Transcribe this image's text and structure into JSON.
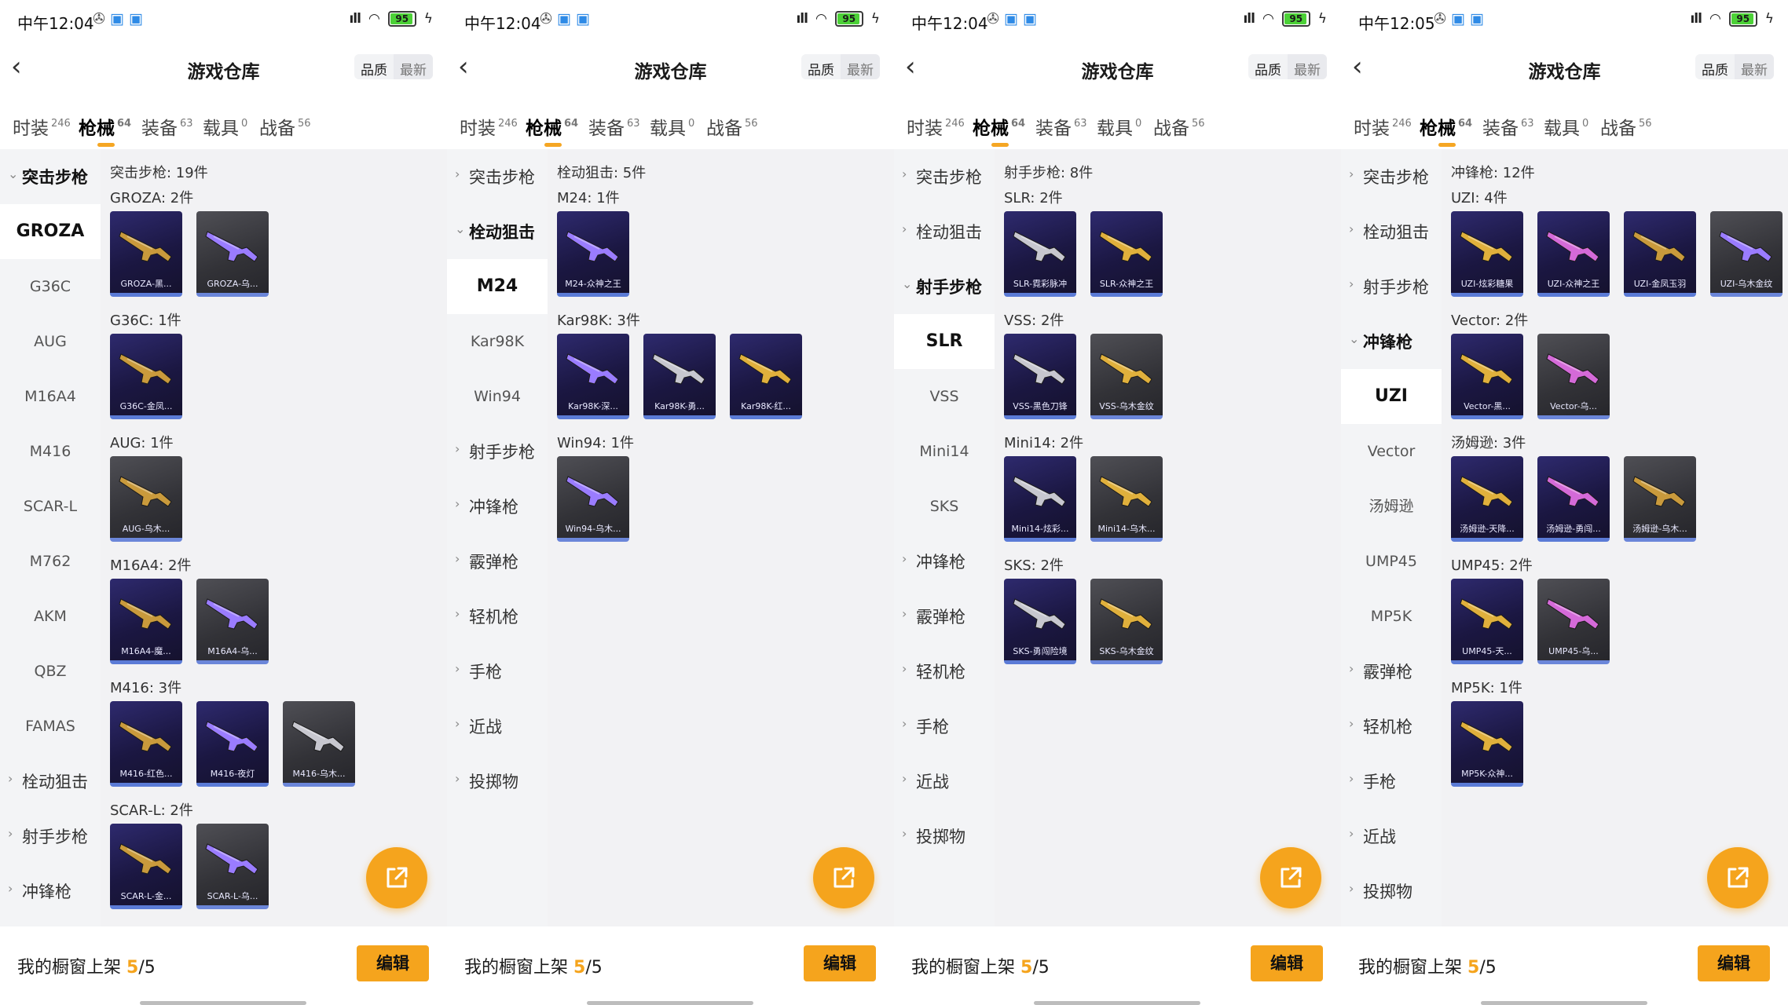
{
  "status_bars": [
    {
      "time": "中午12:04",
      "battery": "95"
    },
    {
      "time": "中午12:04",
      "battery": "95"
    },
    {
      "time": "中午12:04",
      "battery": "95"
    },
    {
      "time": "中午12:05",
      "battery": "95"
    }
  ],
  "header": {
    "title": "游戏仓库",
    "sort_quality": "品质",
    "sort_newest": "最新"
  },
  "tabs": [
    {
      "label": "时装",
      "count": "246"
    },
    {
      "label": "枪械",
      "count": "64"
    },
    {
      "label": "装备",
      "count": "63"
    },
    {
      "label": "载具",
      "count": "0"
    },
    {
      "label": "战备",
      "count": "56"
    }
  ],
  "bottom": {
    "showcase_label": "我的橱窗上架",
    "showcase_current": "5",
    "showcase_total": "/5",
    "edit_label": "编辑"
  },
  "colors": {
    "accent": "#f5a41d",
    "card_purple": "#1b1742",
    "card_grey": "#323237",
    "sidebar_bg": "#f3f4f6"
  },
  "panels": [
    {
      "sidebar": [
        {
          "type": "group",
          "label": "突击步枪",
          "open": true
        },
        {
          "type": "item",
          "label": "GROZA",
          "selected": true
        },
        {
          "type": "item",
          "label": "G36C"
        },
        {
          "type": "item",
          "label": "AUG"
        },
        {
          "type": "item",
          "label": "M16A4"
        },
        {
          "type": "item",
          "label": "M416"
        },
        {
          "type": "item",
          "label": "SCAR-L"
        },
        {
          "type": "item",
          "label": "M762"
        },
        {
          "type": "item",
          "label": "AKM"
        },
        {
          "type": "item",
          "label": "QBZ"
        },
        {
          "type": "item",
          "label": "FAMAS"
        },
        {
          "type": "group",
          "label": "栓动狙击"
        },
        {
          "type": "group",
          "label": "射手步枪"
        },
        {
          "type": "group",
          "label": "冲锋枪"
        }
      ],
      "category_header": "突击步枪: 19件",
      "sections": [
        {
          "header": "GROZA: 2件",
          "items": [
            {
              "label": "GROZA-黑...",
              "style": "purple"
            },
            {
              "label": "GROZA-乌...",
              "style": "grey"
            }
          ]
        },
        {
          "header": "G36C: 1件",
          "items": [
            {
              "label": "G36C-金凤...",
              "style": "purple"
            }
          ]
        },
        {
          "header": "AUG: 1件",
          "items": [
            {
              "label": "AUG-乌木...",
              "style": "grey"
            }
          ]
        },
        {
          "header": "M16A4: 2件",
          "items": [
            {
              "label": "M16A4-魔...",
              "style": "purple"
            },
            {
              "label": "M16A4-乌...",
              "style": "grey"
            }
          ]
        },
        {
          "header": "M416: 3件",
          "items": [
            {
              "label": "M416-红色...",
              "style": "purple"
            },
            {
              "label": "M416-夜灯",
              "style": "purple"
            },
            {
              "label": "M416-乌木...",
              "style": "grey"
            }
          ]
        },
        {
          "header": "SCAR-L: 2件",
          "items": [
            {
              "label": "SCAR-L-金...",
              "style": "purple"
            },
            {
              "label": "SCAR-L-乌...",
              "style": "grey"
            }
          ]
        }
      ]
    },
    {
      "sidebar": [
        {
          "type": "group",
          "label": "突击步枪"
        },
        {
          "type": "group",
          "label": "栓动狙击",
          "open": true
        },
        {
          "type": "item",
          "label": "M24",
          "selected": true
        },
        {
          "type": "item",
          "label": "Kar98K"
        },
        {
          "type": "item",
          "label": "Win94"
        },
        {
          "type": "group",
          "label": "射手步枪"
        },
        {
          "type": "group",
          "label": "冲锋枪"
        },
        {
          "type": "group",
          "label": "霰弹枪"
        },
        {
          "type": "group",
          "label": "轻机枪"
        },
        {
          "type": "group",
          "label": "手枪"
        },
        {
          "type": "group",
          "label": "近战"
        },
        {
          "type": "group",
          "label": "投掷物"
        }
      ],
      "category_header": "栓动狙击: 5件",
      "sections": [
        {
          "header": "M24: 1件",
          "items": [
            {
              "label": "M24-众神之王",
              "style": "purple"
            }
          ]
        },
        {
          "header": "Kar98K: 3件",
          "items": [
            {
              "label": "Kar98K-深...",
              "style": "purple"
            },
            {
              "label": "Kar98K-勇...",
              "style": "purple"
            },
            {
              "label": "Kar98K-红...",
              "style": "purple"
            }
          ]
        },
        {
          "header": "Win94: 1件",
          "items": [
            {
              "label": "Win94-乌木...",
              "style": "grey"
            }
          ]
        }
      ]
    },
    {
      "sidebar": [
        {
          "type": "group",
          "label": "突击步枪"
        },
        {
          "type": "group",
          "label": "栓动狙击"
        },
        {
          "type": "group",
          "label": "射手步枪",
          "open": true
        },
        {
          "type": "item",
          "label": "SLR",
          "selected": true
        },
        {
          "type": "item",
          "label": "VSS"
        },
        {
          "type": "item",
          "label": "Mini14"
        },
        {
          "type": "item",
          "label": "SKS"
        },
        {
          "type": "group",
          "label": "冲锋枪"
        },
        {
          "type": "group",
          "label": "霰弹枪"
        },
        {
          "type": "group",
          "label": "轻机枪"
        },
        {
          "type": "group",
          "label": "手枪"
        },
        {
          "type": "group",
          "label": "近战"
        },
        {
          "type": "group",
          "label": "投掷物"
        }
      ],
      "category_header": "射手步枪: 8件",
      "sections": [
        {
          "header": "SLR: 2件",
          "items": [
            {
              "label": "SLR-霓彩脉冲",
              "style": "purple"
            },
            {
              "label": "SLR-众神之王",
              "style": "purple"
            }
          ]
        },
        {
          "header": "VSS: 2件",
          "items": [
            {
              "label": "VSS-黑色刀锋",
              "style": "purple"
            },
            {
              "label": "VSS-乌木金纹",
              "style": "grey"
            }
          ]
        },
        {
          "header": "Mini14: 2件",
          "items": [
            {
              "label": "Mini14-炫彩...",
              "style": "purple"
            },
            {
              "label": "Mini14-乌木...",
              "style": "grey"
            }
          ]
        },
        {
          "header": "SKS: 2件",
          "items": [
            {
              "label": "SKS-勇闯险境",
              "style": "purple"
            },
            {
              "label": "SKS-乌木金纹",
              "style": "grey"
            }
          ]
        }
      ]
    },
    {
      "sidebar": [
        {
          "type": "group",
          "label": "突击步枪"
        },
        {
          "type": "group",
          "label": "栓动狙击"
        },
        {
          "type": "group",
          "label": "射手步枪"
        },
        {
          "type": "group",
          "label": "冲锋枪",
          "open": true
        },
        {
          "type": "item",
          "label": "UZI",
          "selected": true
        },
        {
          "type": "item",
          "label": "Vector"
        },
        {
          "type": "item",
          "label": "汤姆逊"
        },
        {
          "type": "item",
          "label": "UMP45"
        },
        {
          "type": "item",
          "label": "MP5K"
        },
        {
          "type": "group",
          "label": "霰弹枪"
        },
        {
          "type": "group",
          "label": "轻机枪"
        },
        {
          "type": "group",
          "label": "手枪"
        },
        {
          "type": "group",
          "label": "近战"
        },
        {
          "type": "group",
          "label": "投掷物"
        }
      ],
      "category_header": "冲锋枪: 12件",
      "sections": [
        {
          "header": "UZI: 4件",
          "items": [
            {
              "label": "UZI-炫彩糖果",
              "style": "purple"
            },
            {
              "label": "UZI-众神之王",
              "style": "purple"
            },
            {
              "label": "UZI-金凤玉羽",
              "style": "purple"
            },
            {
              "label": "UZI-乌木金纹",
              "style": "grey"
            }
          ]
        },
        {
          "header": "Vector: 2件",
          "items": [
            {
              "label": "Vector-黑...",
              "style": "purple"
            },
            {
              "label": "Vector-乌...",
              "style": "grey"
            }
          ]
        },
        {
          "header": "汤姆逊: 3件",
          "items": [
            {
              "label": "汤姆逊-天降...",
              "style": "purple"
            },
            {
              "label": "汤姆逊-勇闯...",
              "style": "purple"
            },
            {
              "label": "汤姆逊-乌木...",
              "style": "grey"
            }
          ]
        },
        {
          "header": "UMP45: 2件",
          "items": [
            {
              "label": "UMP45-天...",
              "style": "purple"
            },
            {
              "label": "UMP45-乌...",
              "style": "grey"
            }
          ]
        },
        {
          "header": "MP5K: 1件",
          "items": [
            {
              "label": "MP5K-众神...",
              "style": "purple"
            }
          ]
        }
      ]
    }
  ]
}
